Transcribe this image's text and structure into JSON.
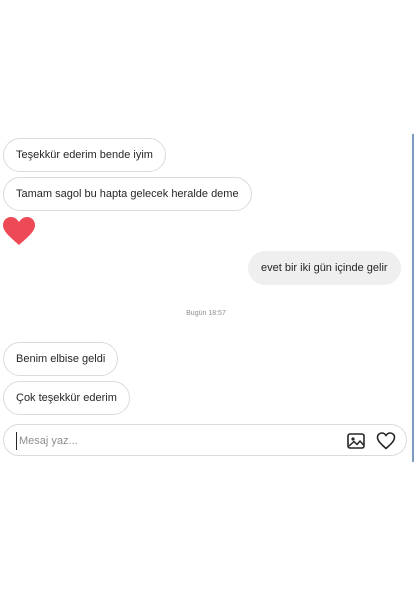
{
  "messages": [
    {
      "text": "Teşekkür ederim bende iyim",
      "direction": "received"
    },
    {
      "text": "Tamam sagol bu hapta gelecek heralde deme",
      "direction": "received"
    },
    {
      "text": "evet bir iki gün içinde gelir",
      "direction": "sent"
    },
    {
      "text": "Benim elbise geldi",
      "direction": "received"
    },
    {
      "text": "Çok teşekkür ederim",
      "direction": "received"
    }
  ],
  "heart_message": {
    "icon": "heart-icon",
    "color": "#ed4956"
  },
  "timestamp": "Bugün 18:57",
  "composer": {
    "placeholder": "Mesaj yaz...",
    "value": "",
    "image_icon": "image-icon",
    "like_icon": "heart-outline-icon"
  },
  "colors": {
    "border": "#dbdbdb",
    "sent_bubble": "#efefef",
    "text": "#262626",
    "muted": "#8e8e8e",
    "accent_border": "#7c9cc4"
  }
}
